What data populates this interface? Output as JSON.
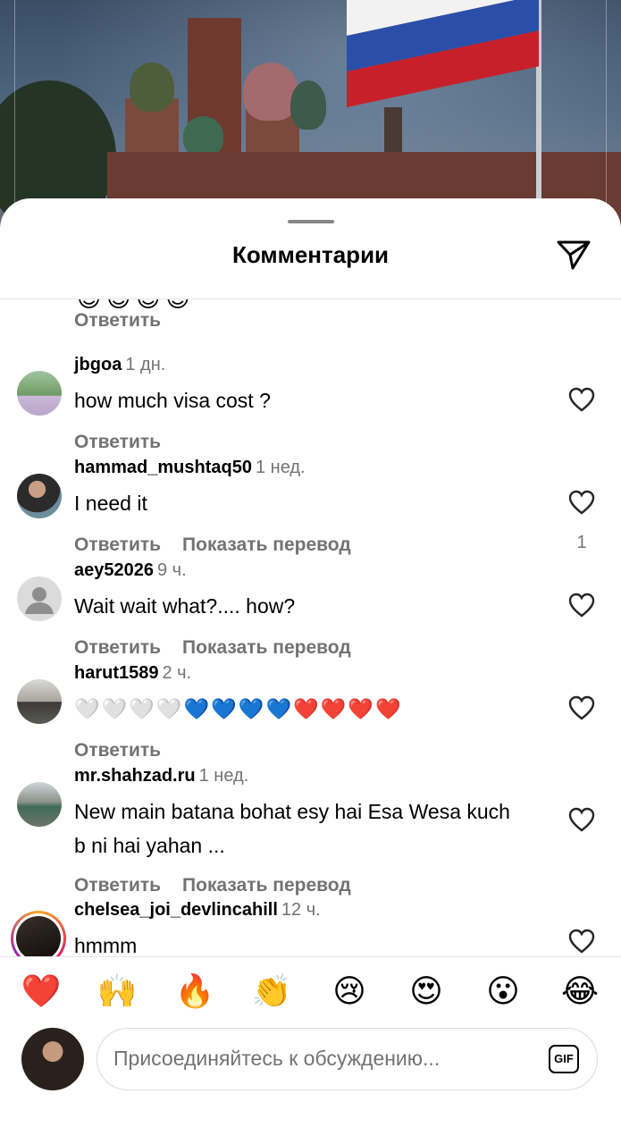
{
  "sheet": {
    "title": "Комментарии",
    "reply_top_label": "Ответить",
    "partial_emoji": "😊😊😊😊"
  },
  "comments": [
    {
      "username": "jbgoa",
      "time": "1 дн.",
      "text": "how much visa cost ?",
      "reply": "Ответить",
      "translate": "",
      "likes": ""
    },
    {
      "username": "hammad_mushtaq50",
      "time": "1 нед.",
      "text": "I need it",
      "reply": "Ответить",
      "translate": "Показать перевод",
      "likes": "1"
    },
    {
      "username": "aey52026",
      "time": "9 ч.",
      "text": "Wait wait what?.... how?",
      "reply": "Ответить",
      "translate": "Показать перевод",
      "likes": ""
    },
    {
      "username": "harut1589",
      "time": "2 ч.",
      "text": "🤍🤍🤍🤍💙💙💙💙❤️❤️❤️❤️",
      "reply": "Ответить",
      "translate": "",
      "likes": ""
    },
    {
      "username": "mr.shahzad.ru",
      "time": "1 нед.",
      "text": "New main batana bohat esy hai Esa Wesa kuch b ni hai yahan ...",
      "reply": "Ответить",
      "translate": "Показать перевод",
      "likes": ""
    },
    {
      "username": "chelsea_joi_devlincahill",
      "time": "12 ч.",
      "text": "hmmm",
      "reply": "",
      "translate": "",
      "likes": ""
    }
  ],
  "reactions": [
    "❤️",
    "🙌",
    "🔥",
    "👏",
    "😢",
    "😍",
    "😮",
    "😂"
  ],
  "composer": {
    "placeholder": "Присоединяйтесь к обсуждению...",
    "gif_label": "GIF"
  },
  "colors": {
    "secondary_text": "#737373",
    "flag_white": "#f2f2f2",
    "flag_blue": "#2b4fa8",
    "flag_red": "#c8202a"
  }
}
